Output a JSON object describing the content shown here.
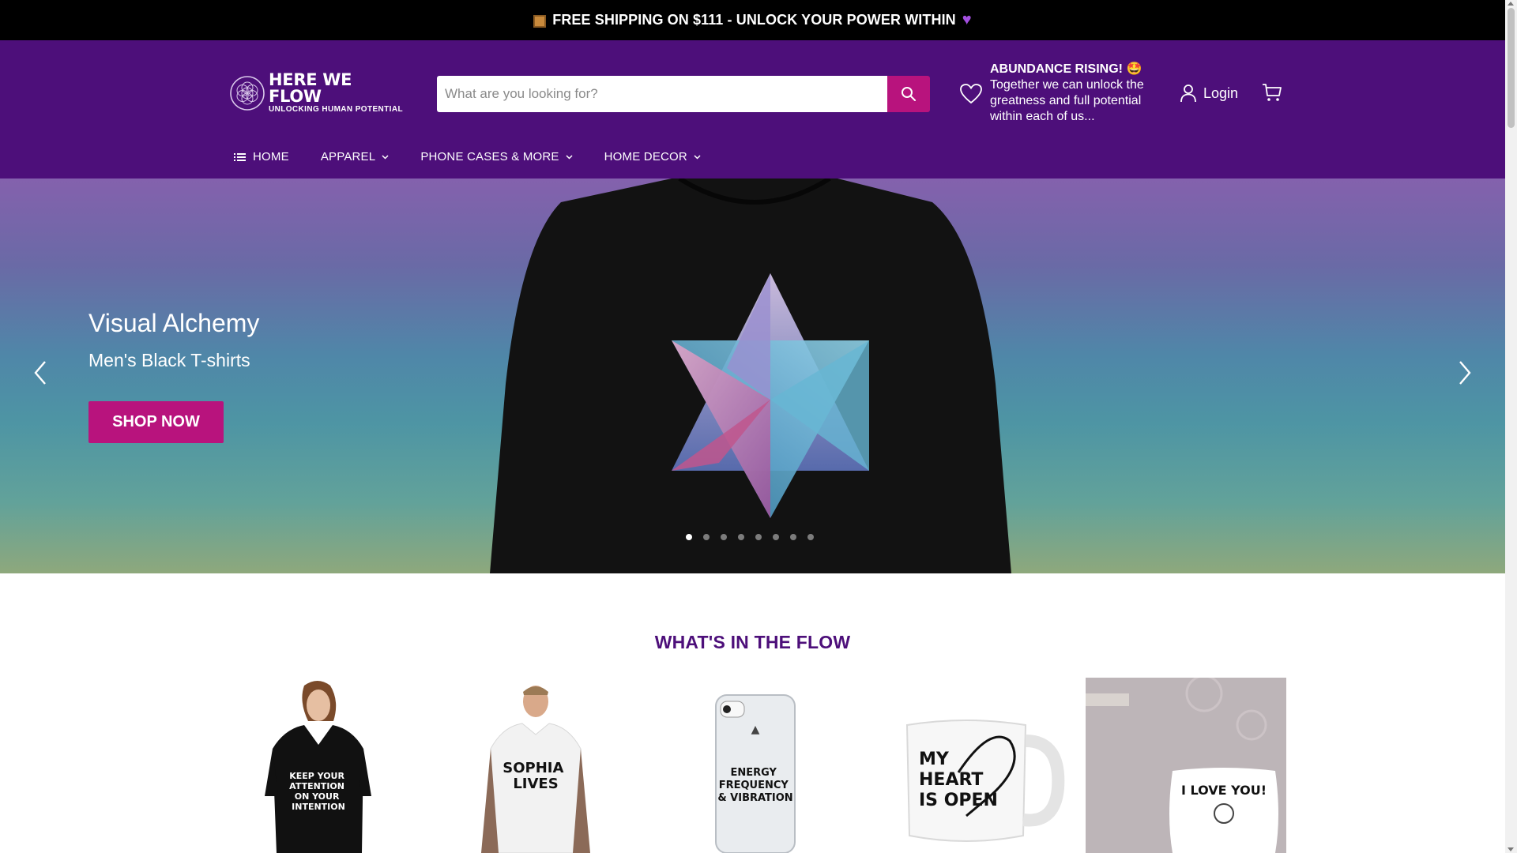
{
  "announcement": {
    "text": "FREE SHIPPING ON $111 - UNLOCK YOUR POWER WITHIN",
    "icon_left": "package-icon",
    "icon_right": "purple-heart-icon"
  },
  "brand": {
    "name": "HERE WE FLOW",
    "tagline": "UNLOCKING HUMAN POTENTIAL",
    "logo_icon": "flower-of-life-icon"
  },
  "search": {
    "placeholder": "What are you looking for?",
    "icon": "search-icon"
  },
  "promo": {
    "title": "ABUNDANCE RISING! 🤩",
    "body": "Together we can unlock the greatness and full potential within each of us...",
    "icon": "heart-outline-icon"
  },
  "account": {
    "login_label": "Login",
    "icon": "user-icon"
  },
  "cart": {
    "icon": "cart-icon"
  },
  "nav": {
    "items": [
      {
        "label": "HOME",
        "has_dropdown": false
      },
      {
        "label": "APPAREL",
        "has_dropdown": true
      },
      {
        "label": "PHONE CASES & MORE",
        "has_dropdown": true
      },
      {
        "label": "HOME DECOR",
        "has_dropdown": true
      }
    ]
  },
  "hero": {
    "title": "Visual Alchemy",
    "subtitle": "Men's Black T-shirts",
    "cta_label": "SHOP NOW",
    "slide_count": 8,
    "active_slide": 1
  },
  "featured": {
    "title": "WHAT'S IN THE FLOW",
    "products": [
      {
        "print_text": "KEEP YOUR ATTENTION ON YOUR INTENTION"
      },
      {
        "print_text": "SOPHIA LIVES"
      },
      {
        "print_text": "ENERGY FREQUENCY & VIBRATION"
      },
      {
        "print_text": "MY HEART IS OPEN"
      },
      {
        "print_text": "I LOVE YOU!"
      }
    ]
  },
  "colors": {
    "brand_purple": "#4d0f7a",
    "accent_magenta": "#b8137d",
    "announcement_bg": "#000000"
  }
}
